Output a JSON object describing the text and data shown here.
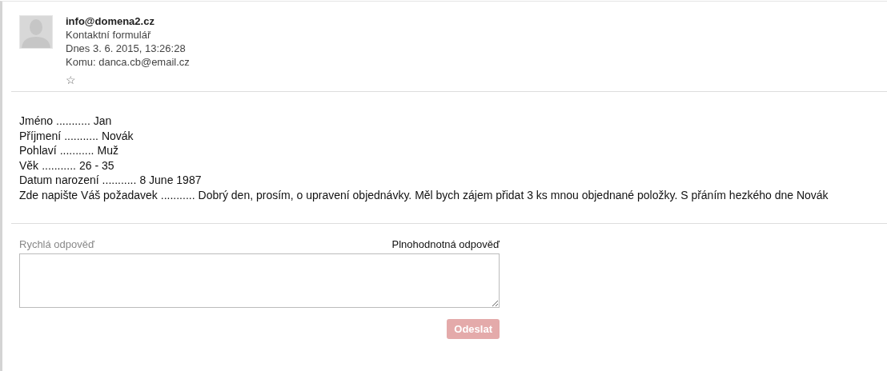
{
  "message": {
    "from": "info@domena2.cz",
    "subject": "Kontaktní formulář",
    "date": "Dnes 3. 6. 2015, 13:26:28",
    "to": "Komu: danca.cb@email.cz",
    "starred": false,
    "star": "☆"
  },
  "fields": [
    {
      "label": "Jméno",
      "dots": "...........",
      "value": "Jan"
    },
    {
      "label": "Příjmení",
      "dots": "...........",
      "value": "Novák"
    },
    {
      "label": "Pohlaví",
      "dots": "...........",
      "value": "Muž"
    },
    {
      "label": "Věk",
      "dots": "...........",
      "value": "26 - 35"
    },
    {
      "label": "Datum narození",
      "dots": "...........",
      "value": "8 June 1987"
    },
    {
      "label": "Zde napište Váš požadavek",
      "dots": "...........",
      "value": "Dobrý den, prosím, o upravení objednávky. Měl bych zájem přidat 3 ks mnou objednané položky. S přáním hezkého dne Novák"
    }
  ],
  "reply": {
    "quick_label": "Rychlá odpověď",
    "full_link": "Plnohodnotná odpověď",
    "send": {
      "label": "Odeslat",
      "disabled": true
    }
  }
}
